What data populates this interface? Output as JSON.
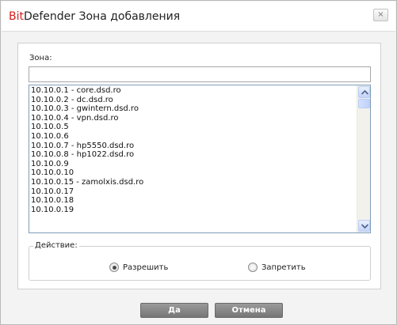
{
  "window": {
    "title_brand": "Bit",
    "title_rest": "Defender Зона добавления",
    "close_glyph": "×"
  },
  "zone": {
    "label": "Зона:",
    "value": "",
    "placeholder": ""
  },
  "list": {
    "items": [
      "10.10.0.1 - core.dsd.ro",
      "10.10.0.2 - dc.dsd.ro",
      "10.10.0.3 - gwintern.dsd.ro",
      "10.10.0.4 - vpn.dsd.ro",
      "10.10.0.5",
      "10.10.0.6",
      "10.10.0.7 - hp5550.dsd.ro",
      "10.10.0.8 - hp1022.dsd.ro",
      "10.10.0.9",
      "10.10.0.10",
      "10.10.0.15 - zamolxis.dsd.ro",
      "10.10.0.17",
      "10.10.0.18",
      "10.10.0.19"
    ]
  },
  "action": {
    "legend": "Действие:",
    "allow_label": "Разрешить",
    "deny_label": "Запретить",
    "selected": "allow"
  },
  "buttons": {
    "ok_label": "Да",
    "cancel_label": "Отмена"
  },
  "colors": {
    "brand": "#d31c1c",
    "button": "#888888",
    "list_border": "#7f9db9"
  }
}
